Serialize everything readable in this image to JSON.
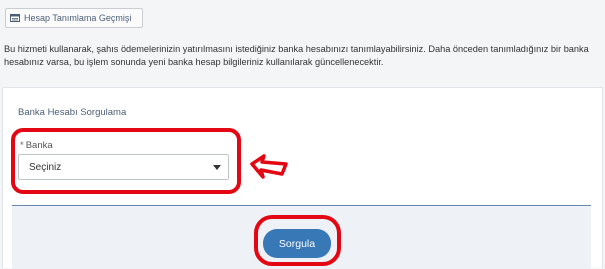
{
  "header": {
    "history_button_label": "Hesap Tanımlama Geçmişi",
    "history_icon": "list-icon"
  },
  "info": {
    "text": "Bu hizmeti kullanarak, şahıs ödemelerinizin yatırılmasını istediğiniz banka hesabınızı tanımlayabilirsiniz. Daha önceden tanımladığınız bir banka hesabınız varsa, bu işlem sonunda yeni banka hesap bilgileriniz kullanılarak güncellenecektir."
  },
  "form": {
    "title": "Banka Hesabı Sorgulama",
    "bank_field": {
      "required_mark": "*",
      "label": "Banka",
      "selected_value": "Seçiniz"
    },
    "submit_label": "Sorgula"
  },
  "annotations": {
    "highlight_color": "#e30613"
  },
  "colors": {
    "primary_button": "#3878b7",
    "page_background": "#f4f5f7",
    "footer_background": "#eef1f6"
  }
}
